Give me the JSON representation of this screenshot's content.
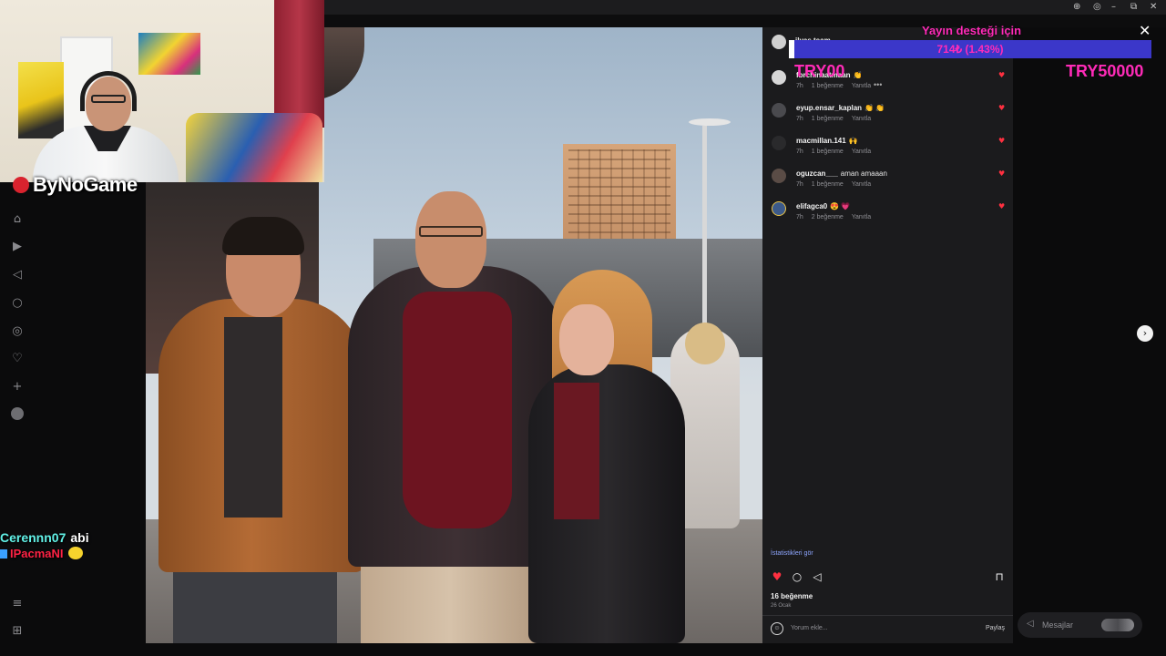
{
  "webcam": {
    "logo_text": "ByNoGame"
  },
  "window_controls": {
    "zoom": "⊕",
    "minimize": "–",
    "restore": "⧉",
    "close": "✕"
  },
  "nav_icons": [
    "home-icon",
    "reels-icon",
    "direct-icon",
    "search-icon",
    "explore-icon",
    "heart-icon",
    "create-icon",
    "profile-icon",
    "menu-icon",
    "more-icon"
  ],
  "post": {
    "close_glyph": "✕",
    "next_glyph": "›",
    "header_user": "ilyas.team"
  },
  "comments": [
    {
      "user": "fbrchinaatmaan",
      "text": "👏",
      "time": "7h",
      "likes": "1 beğenme",
      "reply": "Yanıtla"
    },
    {
      "user": "eyup.ensar_kaplan",
      "text": "👏 👏",
      "time": "7h",
      "likes": "1 beğenme",
      "reply": "Yanıtla"
    },
    {
      "user": "macmillan.141",
      "text": "🙌",
      "time": "7h",
      "likes": "1 beğenme",
      "reply": "Yanıtla"
    },
    {
      "user": "oguzcan___",
      "text": "aman amaaan",
      "time": "7h",
      "likes": "1 beğenme",
      "reply": "Yanıtla"
    },
    {
      "user": "elifagca0",
      "text": "😍 💗",
      "time": "7h",
      "likes": "2 beğenme",
      "reply": "Yanıtla"
    }
  ],
  "comment_more_glyph": "•••",
  "stats_link": "İstatistikleri gör",
  "likes_count": "16 beğenme",
  "post_date": "26 Ocak",
  "comment_input_placeholder": "Yorum ekle...",
  "share_label": "Paylaş",
  "donation": {
    "title": "Yayın desteği için",
    "progress_text": "714₺ (1.43%)",
    "progress_percent": 1.43,
    "left_label": "TRY00",
    "right_label": "TRY50000"
  },
  "messages": {
    "label": "Mesajlar"
  },
  "chat": {
    "line1_user": "Cerennn07",
    "line1_msg": "abi",
    "line2_user": "IPacmaNI"
  },
  "colors": {
    "accent_pink": "#ff2bb8",
    "like_red": "#ff3040",
    "progress_blue": "#3b37c9"
  }
}
